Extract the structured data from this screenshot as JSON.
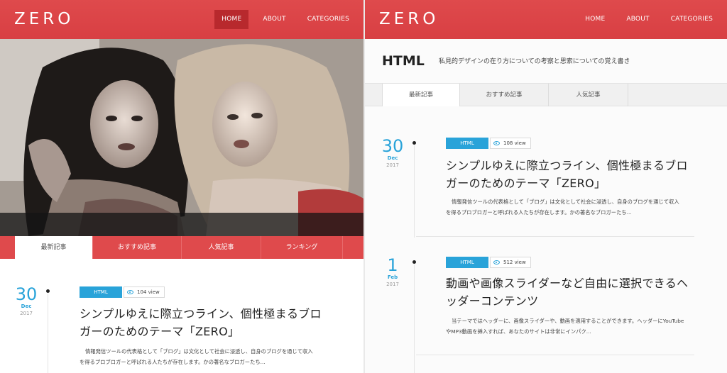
{
  "left": {
    "logo": "ZERO",
    "nav": [
      {
        "label": "HOME",
        "active": true
      },
      {
        "label": "ABOUT",
        "active": false
      },
      {
        "label": "CATEGORIES",
        "active": false
      }
    ],
    "tabs": [
      "最新記事",
      "おすすめ記事",
      "人気記事",
      "ランキング"
    ],
    "article": {
      "day": "30",
      "month": "Dec",
      "year": "2017",
      "category": "HTML",
      "views": "104 view",
      "title_line1": "シンプルゆえに際立つライン、個性極まるブロ",
      "title_line2": "ガーのためのテーマ「ZERO」",
      "excerpt_line1": "情報発信ツールの代表格として「ブログ」は文化として社会に浸透し、自身のブログを通じて収入",
      "excerpt_line2": "を得るプロブロガーと呼ばれる人たちが存在します。かの著名なブロガーたち..."
    }
  },
  "right": {
    "logo": "ZERO",
    "nav": [
      {
        "label": "HOME"
      },
      {
        "label": "ABOUT"
      },
      {
        "label": "CATEGORIES"
      }
    ],
    "page_title": "HTML",
    "page_desc": "私見的デザインの在り方についての考察と思索についての覚え書き",
    "tabs": [
      "最新記事",
      "おすすめ記事",
      "人気記事"
    ],
    "articles": [
      {
        "day": "30",
        "month": "Dec",
        "year": "2017",
        "category": "HTML",
        "views": "108 view",
        "title_line1": "シンプルゆえに際立つライン、個性極まるブロ",
        "title_line2": "ガーのためのテーマ「ZERO」",
        "excerpt_line1": "情報発信ツールの代表格として「ブログ」は文化として社会に浸透し、自身のブログを通じて収入",
        "excerpt_line2": "を得るプロブロガーと呼ばれる人たちが存在します。かの著名なブロガーたち..."
      },
      {
        "day": "1",
        "month": "Feb",
        "year": "2017",
        "category": "HTML",
        "views": "512 view",
        "title_line1": "動画や画像スライダーなど自由に選択できるヘ",
        "title_line2": "ッダーコンテンツ",
        "excerpt_line1": "当テーマではヘッダーに、画像スライダーや、動画を適用することができます。ヘッダーにYouTube",
        "excerpt_line2": "やMP3動画を挿入すれば、あなたのサイトは非常にインパク..."
      }
    ]
  },
  "colors": {
    "brand_red": "#df4a4c",
    "nav_active": "#b8292d",
    "accent_blue": "#29a3d9"
  }
}
